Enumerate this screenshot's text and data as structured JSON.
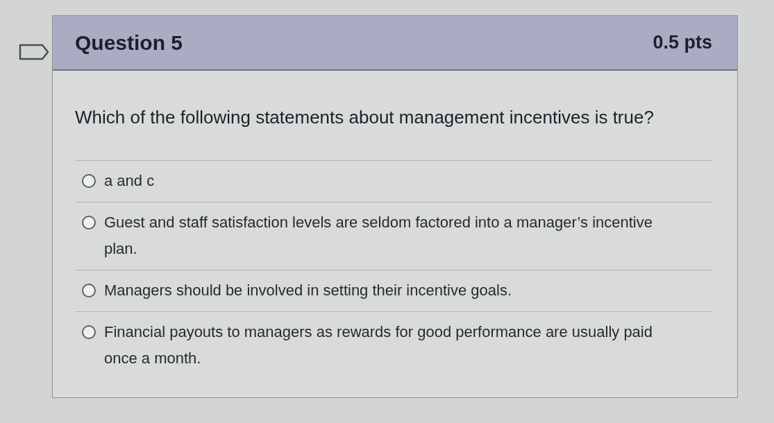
{
  "question": {
    "title": "Question 5",
    "points": "0.5 pts",
    "flagged": false,
    "prompt": "Which of the following statements about management incentives is true?"
  },
  "answers": [
    {
      "label": "a and c",
      "selected": false
    },
    {
      "label": "Guest and staff satisfaction levels are seldom factored into a manager’s incentive plan.",
      "selected": false
    },
    {
      "label": "Managers should be involved in setting their incentive goals.",
      "selected": false
    },
    {
      "label": "Financial payouts to managers as rewards for good performance are usually paid once a month.",
      "selected": false
    }
  ]
}
